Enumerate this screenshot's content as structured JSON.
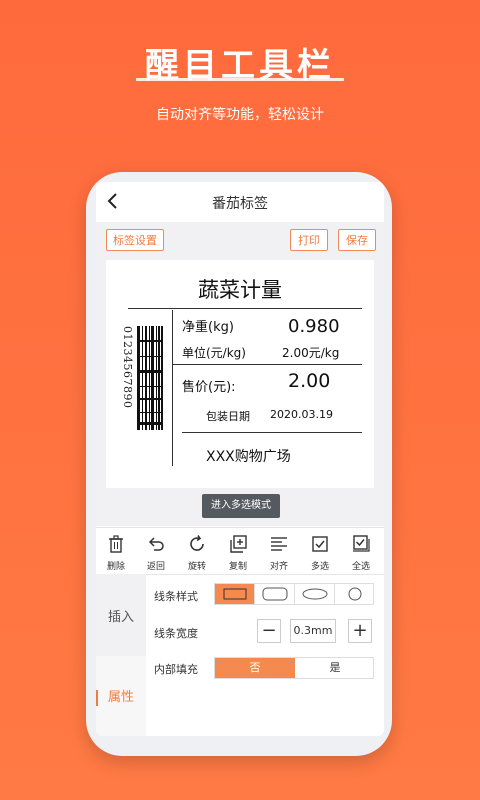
{
  "promo": {
    "headline": "醒目工具栏",
    "subline": "自动对齐等功能，轻松设计"
  },
  "app": {
    "title": "番茄标签",
    "buttons": {
      "label_settings": "标签设置",
      "print": "打印",
      "save": "保存"
    },
    "label": {
      "title": "蔬菜计量",
      "barcode_number": "01234567890",
      "net_weight_label": "净重(kg)",
      "net_weight_value": "0.980",
      "unit_price_label": "单位(元/kg)",
      "unit_price_value": "2.00元/kg",
      "price_label": "售价(元):",
      "price_value": "2.00",
      "pack_date_label": "包装日期",
      "pack_date_value": "2020.03.19",
      "store": "XXX购物广场"
    },
    "multi_select_mode_button": "进入多选模式",
    "tools": [
      {
        "label": "删除",
        "icon": "trash-icon"
      },
      {
        "label": "返回",
        "icon": "undo-icon"
      },
      {
        "label": "旋转",
        "icon": "rotate-icon"
      },
      {
        "label": "复制",
        "icon": "copy-icon"
      },
      {
        "label": "对齐",
        "icon": "align-icon"
      },
      {
        "label": "多选",
        "icon": "checkbox-icon"
      },
      {
        "label": "全选",
        "icon": "select-all-icon"
      }
    ],
    "insert_tab": "插入",
    "properties": {
      "line_style_label": "线条样式",
      "line_width_label": "线条宽度",
      "line_width_value": "0.3mm",
      "minus": "−",
      "plus": "+",
      "inner_fill_label": "内部填充",
      "fill_no": "否",
      "fill_yes": "是",
      "section_title": "属性"
    },
    "colors": {
      "accent": "#f07c44",
      "background": "#ff6a3c"
    }
  }
}
